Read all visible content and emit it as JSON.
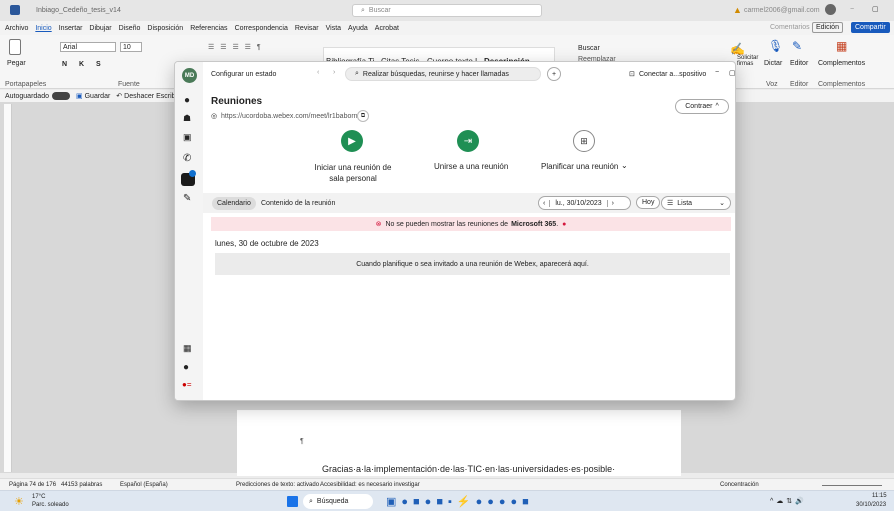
{
  "titlebar": {
    "filename": "Inbiago_Cedeño_tesis_v14",
    "search": "Buscar",
    "account": "carmel2006@gmail.com"
  },
  "menu": {
    "items": [
      "Archivo",
      "Inicio",
      "Insertar",
      "Dibujar",
      "Diseño",
      "Disposición",
      "Referencias",
      "Correspondencia",
      "Revisar",
      "Vista",
      "Ayuda",
      "Acrobat"
    ],
    "comentarios": "Comentarios",
    "edicion": "Edición",
    "compartir": "Compartir"
  },
  "ribbon": {
    "paste": "Pegar",
    "portapapeles": "Portapapeles",
    "font": "Arial",
    "size": "10",
    "fuente": "Fuente",
    "styles": [
      "Bibliografía Ti...",
      "Citas Tesis",
      "Cuerpo texto I...",
      "Descripción"
    ],
    "buscar": "Buscar",
    "reemplazar": "Reemplazar",
    "solicitar": "Solicitar firmas",
    "dictar": "Dictar",
    "voz": "Voz",
    "editor": "Editor",
    "complementos": "Complementos"
  },
  "qat": {
    "autoguardado": "Autoguardado",
    "guardar": "Guardar",
    "deshacer": "Deshacer Escribir e"
  },
  "document": {
    "pilcrow": "¶",
    "line": "Gracias·a·la·implementación·de·las·TIC·en·las·universidades·es·posible·"
  },
  "status": {
    "page": "Página 74 de 176",
    "words": "44153 palabras",
    "lang": "Español (España)",
    "pred": "Predicciones de texto: activado",
    "acc": "Accesibilidad: es necesario investigar",
    "concentracion": "Concentración"
  },
  "taskbar": {
    "temp": "17°C",
    "weather": "Parc. soleado",
    "search": "Búsqueda",
    "time": "11:15",
    "date": "30/10/2023"
  },
  "webex": {
    "avatar": "MD",
    "status": "Configurar un estado",
    "search": "Realizar búsquedas, reunirse y hacer llamadas",
    "connect": "Conectar a...spositivo",
    "title": "Reuniones",
    "url": "https://ucordoba.webex.com/meet/lr1baborn",
    "collapse": "Contraer",
    "actions": {
      "personal": "Iniciar una reunión de sala personal",
      "join": "Unirse a una reunión",
      "plan": "Planificar una reunión"
    },
    "tabs": {
      "calendar": "Calendario",
      "content": "Contenido de la reunión"
    },
    "date": "lu., 30/10/2023",
    "today": "Hoy",
    "view": "Lista",
    "error_prefix": "No se pueden mostrar las reuniones de",
    "error_brand": "Microsoft 365",
    "day": "lunes, 30 de octubre de 2023",
    "empty": "Cuando planifique o sea invitado a una reunión de Webex, aparecerá aquí."
  }
}
